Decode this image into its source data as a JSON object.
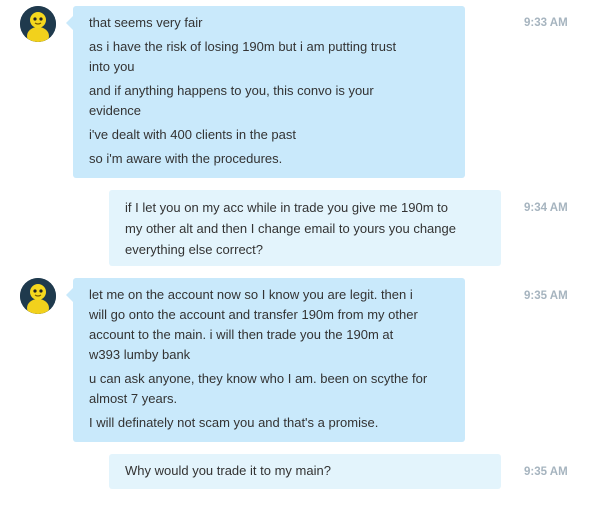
{
  "messages": [
    {
      "direction": "incoming",
      "time": "9:33 AM",
      "lines": [
        "that seems very fair",
        "as i have the risk of losing 190m but i am putting trust",
        "into you",
        "and if anything happens to you, this convo is your",
        "evidence",
        "i've dealt with 400 clients in the past",
        "so i'm aware with the procedures."
      ]
    },
    {
      "direction": "outgoing",
      "time": "9:34 AM",
      "lines": [
        "if I let you on my acc while in trade you give me 190m to",
        "my other alt and then I change email to yours you change",
        "everything else correct?"
      ]
    },
    {
      "direction": "incoming",
      "time": "9:35 AM",
      "lines": [
        "let me on the account now so I know you are legit. then i",
        "will go onto the account and transfer 190m from my other",
        "account to the main. i will then trade you the 190m at",
        "w393 lumby bank",
        "u can ask anyone, they know who I am. been on scythe for",
        "almost 7 years.",
        "I will definately not scam you and that's a promise."
      ]
    },
    {
      "direction": "outgoing",
      "time": "9:35 AM",
      "lines": [
        "Why would you trade it to my main?"
      ]
    }
  ],
  "avatar_icon": "yellow-character-avatar-icon",
  "colors": {
    "incoming_bubble": "#c9e9fb",
    "outgoing_bubble": "#e3f4fc",
    "timestamp": "#a6b4bf",
    "text": "#333333"
  }
}
